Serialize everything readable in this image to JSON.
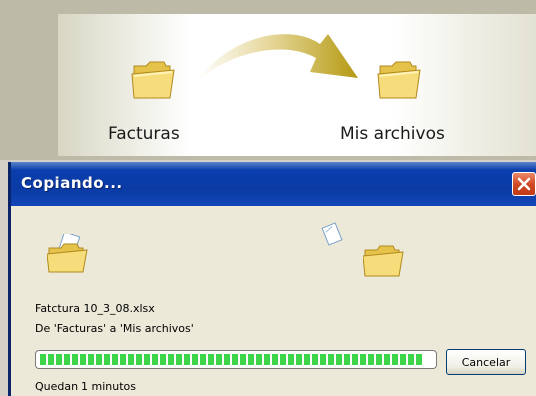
{
  "illustration": {
    "source_folder_label": "Facturas",
    "destination_folder_label": "Mis archivos",
    "source_icon": "folder-icon",
    "destination_icon": "folder-icon",
    "arrow_icon": "curved-arrow-icon"
  },
  "dialog": {
    "title": "Copiando...",
    "close_icon": "close-icon",
    "file_name": "Fatctura 10_3_08.xlsx",
    "from_to": "De 'Facturas' a 'Mis archivos'",
    "progress_percent": 98,
    "cancel_label": "Cancelar",
    "remaining_label": "Quedan",
    "remaining_value": "1 minutos"
  },
  "colors": {
    "titlebar": "#0a3aa4",
    "progress": "#3dd64a",
    "close_button": "#d24a25"
  }
}
